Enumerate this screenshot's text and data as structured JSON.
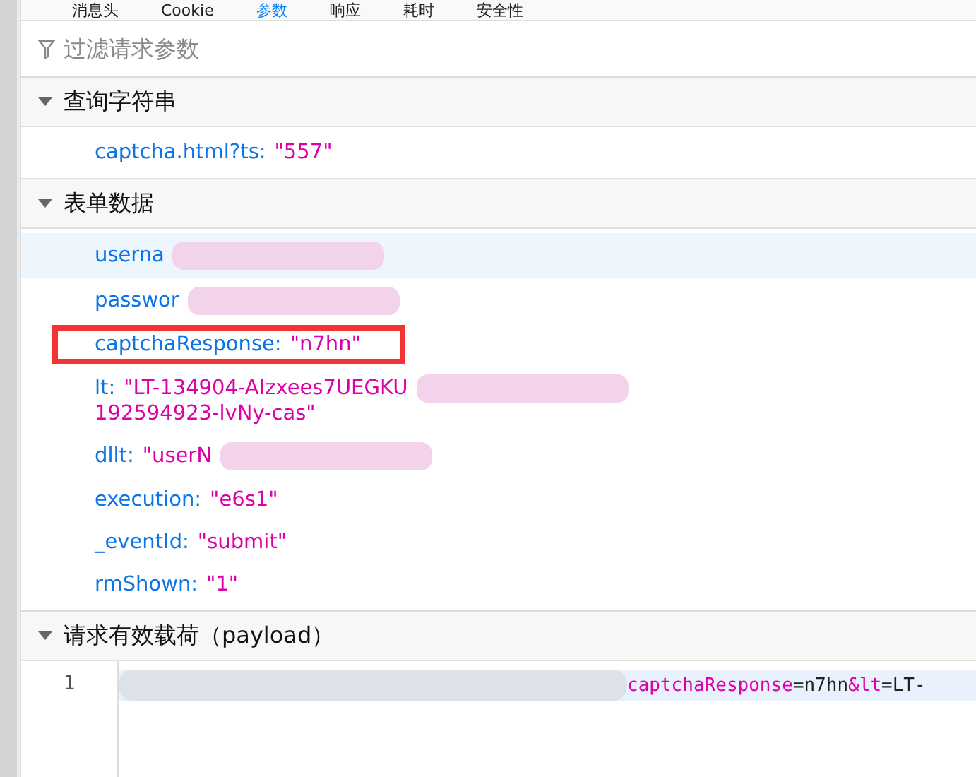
{
  "tabs": [
    {
      "label": "消息头",
      "selected": false
    },
    {
      "label": "Cookie",
      "selected": false
    },
    {
      "label": "参数",
      "selected": true
    },
    {
      "label": "响应",
      "selected": false
    },
    {
      "label": "耗时",
      "selected": false
    },
    {
      "label": "安全性",
      "selected": false
    }
  ],
  "filter": {
    "placeholder": "过滤请求参数"
  },
  "sections": [
    {
      "title": "查询字符串",
      "expanded": true,
      "params": [
        {
          "key": "captcha.html?ts:",
          "value": "\"557\"",
          "selected": false,
          "highlighted": false,
          "redacted": false
        }
      ]
    },
    {
      "title": "表单数据",
      "expanded": true,
      "params": [
        {
          "key": "userna",
          "selected": true,
          "highlighted": false,
          "redacted": true
        },
        {
          "key": "passwor",
          "selected": false,
          "highlighted": false,
          "redacted": true
        },
        {
          "key": "captchaResponse:",
          "value": "\"n7hn\"",
          "selected": false,
          "highlighted": true,
          "redacted": false
        },
        {
          "key": "lt:",
          "value": "\"LT-134904-AIzxees7UEGKU",
          "value_after": "192594923-lvNy-cas\"",
          "selected": false,
          "highlighted": false,
          "redacted": true
        },
        {
          "key": "dllt:",
          "value": "\"userN",
          "selected": false,
          "highlighted": false,
          "redacted": true
        },
        {
          "key": "execution:",
          "value": "\"e6s1\"",
          "selected": false,
          "highlighted": false,
          "redacted": false
        },
        {
          "key": "_eventId:",
          "value": "\"submit\"",
          "selected": false,
          "highlighted": false,
          "redacted": false
        },
        {
          "key": "rmShown:",
          "value": "\"1\"",
          "selected": false,
          "highlighted": false,
          "redacted": false
        }
      ]
    }
  ],
  "payload": {
    "title": "请求有效载荷（payload）",
    "expanded": true,
    "line_number": "1",
    "redacted": true,
    "tokens": [
      {
        "kind": "key",
        "text": "captchaResponse"
      },
      {
        "kind": "plain",
        "text": "=n7hn"
      },
      {
        "kind": "key",
        "text": "&lt"
      },
      {
        "kind": "plain",
        "text": "=LT-"
      }
    ]
  }
}
